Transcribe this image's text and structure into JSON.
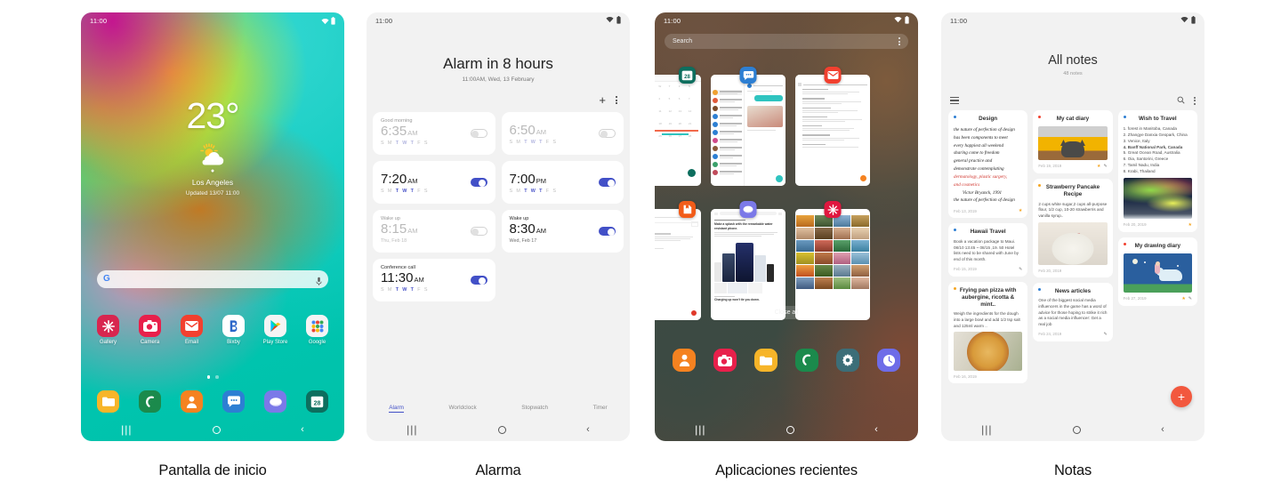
{
  "captions": [
    {
      "id": "home",
      "label": "Pantalla de inicio"
    },
    {
      "id": "alarm",
      "label": "Alarma"
    },
    {
      "id": "recents",
      "label": "Aplicaciones recientes"
    },
    {
      "id": "notes",
      "label": "Notas"
    }
  ],
  "status_bar": {
    "time": "11:00",
    "wifi_icon": "wifi-icon",
    "battery_icon": "battery-icon"
  },
  "nav_bar": {
    "recents_icon": "recents-icon",
    "home_icon": "home-icon",
    "back_icon": "back-icon"
  },
  "home": {
    "weather": {
      "temperature": "23°",
      "condition_icon": "partly-cloudy-icon",
      "location": "Los Angeles",
      "updated": "Updated 13/07 11:00",
      "refresh_icon": "refresh-icon",
      "pin_icon": "location-pin-icon"
    },
    "search": {
      "google_icon": "google-g-icon",
      "mic_icon": "microphone-icon",
      "placeholder": ""
    },
    "apps": [
      {
        "label": "Gallery",
        "icon": "gallery-icon",
        "color": "#d8264f"
      },
      {
        "label": "Camera",
        "icon": "camera-icon",
        "color": "#e8204b"
      },
      {
        "label": "Email",
        "icon": "email-icon",
        "color": "#f2402f"
      },
      {
        "label": "Bixby",
        "icon": "bixby-icon",
        "color": "#ffffff"
      },
      {
        "label": "Play Store",
        "icon": "play-store-icon",
        "color": "#f4f4f4"
      },
      {
        "label": "Google",
        "icon": "google-folder-icon",
        "color": "#f4f4f4"
      }
    ],
    "page_dots": {
      "count": 2,
      "active_index": 0
    },
    "dock": [
      {
        "icon": "my-files-icon",
        "color": "#f7b529"
      },
      {
        "icon": "phone-icon",
        "color": "#1b8a4c"
      },
      {
        "icon": "contacts-icon",
        "color": "#f58220"
      },
      {
        "icon": "messages-icon",
        "color": "#2d7fd3"
      },
      {
        "icon": "internet-icon",
        "color": "#7b79e8"
      },
      {
        "icon": "calendar-icon",
        "color": "#0d6e5e",
        "badge": "28"
      }
    ]
  },
  "alarm": {
    "title": "Alarm in 8 hours",
    "subtitle": "11:00AM, Wed, 13 February",
    "add_icon": "plus-icon",
    "more_icon": "more-options-icon",
    "alarms": [
      {
        "name": "Good morning",
        "time": "6:35",
        "meridiem": "AM",
        "days": "SMTWTFS",
        "bold_days": [
          2,
          3,
          4
        ],
        "sub": "",
        "on": false
      },
      {
        "name": "",
        "time": "6:50",
        "meridiem": "AM",
        "days": "SMTWTFS",
        "bold_days": [
          2,
          3,
          4
        ],
        "sub": "",
        "on": false
      },
      {
        "name": "",
        "time": "7:20",
        "meridiem": "AM",
        "days": "SMTWTFS",
        "bold_days": [
          2,
          3,
          4
        ],
        "sub": "",
        "on": true
      },
      {
        "name": "",
        "time": "7:00",
        "meridiem": "PM",
        "days": "SMTWTFS",
        "bold_days": [
          2,
          3,
          4
        ],
        "sub": "",
        "on": true
      },
      {
        "name": "Wake up",
        "time": "8:15",
        "meridiem": "AM",
        "days": "",
        "sub": "Thu, Feb 18",
        "on": false
      },
      {
        "name": "Wake up",
        "time": "8:30",
        "meridiem": "AM",
        "days": "",
        "sub": "Wed, Feb 17",
        "on": true
      },
      {
        "name": "Conference call",
        "time": "11:30",
        "meridiem": "AM",
        "days": "SMTWTFS",
        "bold_days": [
          2,
          3,
          4
        ],
        "sub": "",
        "on": true
      }
    ],
    "tabs": [
      {
        "label": "Alarm",
        "selected": true
      },
      {
        "label": "Worldclock",
        "selected": false
      },
      {
        "label": "Stopwatch",
        "selected": false
      },
      {
        "label": "Timer",
        "selected": false
      }
    ]
  },
  "recents": {
    "search_placeholder": "Search",
    "search_more_icon": "more-options-icon",
    "close_all_label": "Close all",
    "thumbnails": [
      {
        "app": "Calendar",
        "icon": "calendar-icon",
        "color": "#0d6e5e",
        "badge": "28"
      },
      {
        "app": "Messages",
        "icon": "messages-icon",
        "color": "#2d7fd3"
      },
      {
        "app": "Email",
        "icon": "email-icon",
        "color": "#f2402f"
      },
      {
        "app": "Samsung Notes",
        "icon": "notes-icon",
        "color": "#f25c19"
      },
      {
        "app": "Internet",
        "icon": "internet-icon",
        "color": "#7b79e8"
      },
      {
        "app": "Gallery",
        "icon": "gallery-icon",
        "color": "#e0173f"
      }
    ],
    "dock": [
      {
        "icon": "contacts-icon",
        "color": "#f58220"
      },
      {
        "icon": "camera-icon",
        "color": "#e8204b"
      },
      {
        "icon": "my-files-icon",
        "color": "#f7b529"
      },
      {
        "icon": "phone-icon",
        "color": "#1b8a4c"
      },
      {
        "icon": "settings-icon",
        "color": "#3c6e78"
      },
      {
        "icon": "clock-icon",
        "color": "#6e6ce8"
      }
    ]
  },
  "notes": {
    "title": "All notes",
    "count": "48 notes",
    "menu_icon": "hamburger-icon",
    "search_icon": "search-icon",
    "more_icon": "more-options-icon",
    "fab_icon": "add-note-icon",
    "columns": [
      [
        {
          "title": "Design",
          "dot_color": "#2d7fd3",
          "type": "handwriting",
          "lines": [
            {
              "text": "the nature of perfection of design",
              "red": false
            },
            {
              "text": "has been components to meet",
              "red": false
            },
            {
              "text": "every happiest all weekend",
              "red": false
            },
            {
              "text": "sharing come to freedom",
              "red": false
            },
            {
              "text": "general practice and",
              "red": false
            },
            {
              "text": "demonstrate contemplating",
              "red": false
            },
            {
              "text": "dermatology, plastic surgery,",
              "red": true
            },
            {
              "text": "and cosmetics",
              "red": true
            },
            {
              "text": "Victor Bryanck, 1991",
              "red": false
            },
            {
              "text": "the nature of perfection of design",
              "red": false
            }
          ],
          "date": "Feb 13, 2019",
          "icons": [
            "star"
          ]
        },
        {
          "title": "Hawaii Travel",
          "dot_color": "#2d7fd3",
          "type": "text",
          "body": "Book a vacation  package to Maui. 08/10 13:45 ~ 08/15 ,19. 50 Hotel lists need to be shared with June by end of this month.",
          "date": "Feb 15, 2019",
          "icons": [
            "pen"
          ]
        },
        {
          "title": "Frying pan pizza with aubergine, ricotta & mint..",
          "dot_color": "#f5a623",
          "type": "text-image",
          "body": "Weigh the ingredients for the dough into a large bowl and add 1/2 tsp salt and 125ml warm ..",
          "image": "pizza",
          "date": "Feb 16, 2019",
          "icons": []
        }
      ],
      [
        {
          "title": "My cat diary",
          "dot_color": "#f2402f",
          "type": "image",
          "image": "cat",
          "date": "Feb 19, 2019",
          "icons": [
            "star",
            "pen"
          ]
        },
        {
          "title": "Strawberry Pancake Recipe",
          "dot_color": "#f5a623",
          "type": "text-image",
          "body": "2 cups white sugar,2 cups all-purpose flour, 1/2 cup, 10-20 strawberris and vanilla syrup..",
          "image": "pancake",
          "date": "Feb 20, 2019",
          "icons": []
        },
        {
          "title": "News articles",
          "dot_color": "#2d7fd3",
          "type": "text",
          "body": "One of the biggest social media influencers in the game has a word of advice for those hoping to strike it rich as a social media influencer: Get a real job",
          "date": "Feb 24, 2019",
          "icons": [
            "pen"
          ]
        }
      ],
      [
        {
          "title": "Wish to Travel",
          "dot_color": "#2d7fd3",
          "type": "list-image",
          "list": [
            "1. forest in Manitoba, Canada",
            "2. Zhangye Danxia Geopark, China",
            "3. Venice, Italy",
            "4. Banff National Park, Canada",
            "5. Great Ocean Road, Australia",
            "6. Oia, Santorini, Greece",
            "7. Tamil Nadu, India",
            "8. Krabi, Thailand"
          ],
          "image": "aurora",
          "date": "Feb 20, 2019",
          "icons": [
            "star"
          ]
        },
        {
          "title": "My drawing diary",
          "dot_color": "#f2402f",
          "type": "image",
          "image": "drawing",
          "date": "Feb 27, 2019",
          "icons": [
            "star",
            "pen"
          ]
        }
      ]
    ]
  }
}
